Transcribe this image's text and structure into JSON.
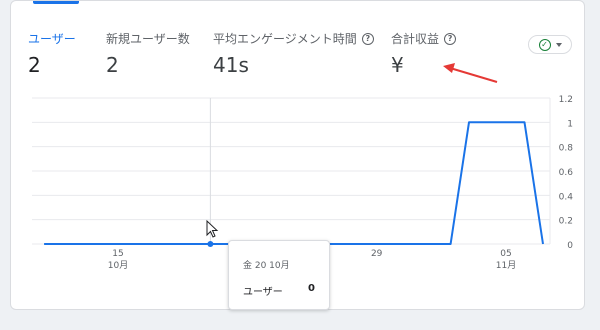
{
  "metrics": [
    {
      "label": "ユーザー",
      "value": "2",
      "help": false
    },
    {
      "label": "新規ユーザー数",
      "value": "2",
      "help": false
    },
    {
      "label": "平均エンゲージメント時間",
      "value": "41s",
      "help": true
    },
    {
      "label": "合計収益",
      "value": "¥",
      "help": true
    }
  ],
  "help_icon": "?",
  "check_dropdown": {
    "icon": "check-circle-icon"
  },
  "annotation": {
    "color": "#e53935"
  },
  "tooltip": {
    "date": "金 20 10月",
    "label": "ユーザー",
    "value": "0"
  },
  "chart_data": {
    "type": "line",
    "x": [
      "10/11",
      "10/12",
      "10/13",
      "10/14",
      "10/15",
      "10/16",
      "10/17",
      "10/18",
      "10/19",
      "10/20",
      "10/21",
      "10/22",
      "10/23",
      "10/24",
      "10/25",
      "10/26",
      "10/27",
      "10/28",
      "10/29",
      "10/30",
      "10/31",
      "11/01",
      "11/02",
      "11/03",
      "11/04",
      "11/05",
      "11/06",
      "11/07"
    ],
    "series": [
      {
        "values": [
          0,
          0,
          0,
          0,
          0,
          0,
          0,
          0,
          0,
          0,
          0,
          0,
          0,
          0,
          0,
          0,
          0,
          0,
          0,
          0,
          0,
          0,
          0,
          1,
          1,
          1,
          1,
          0
        ],
        "color": "#1a73e8"
      }
    ],
    "x_ticks": [
      {
        "x": "10/15",
        "label": "15",
        "sublabel": "10月"
      },
      {
        "x": "10/29",
        "label": "29",
        "sublabel": ""
      },
      {
        "x": "11/05",
        "label": "05",
        "sublabel": "11月"
      }
    ],
    "y_ticks": [
      "0",
      "0.2",
      "0.4",
      "0.6",
      "0.8",
      "1",
      "1.2"
    ],
    "ylim": [
      0,
      1.2
    ],
    "highlight_x": "10/20",
    "grid": true
  }
}
